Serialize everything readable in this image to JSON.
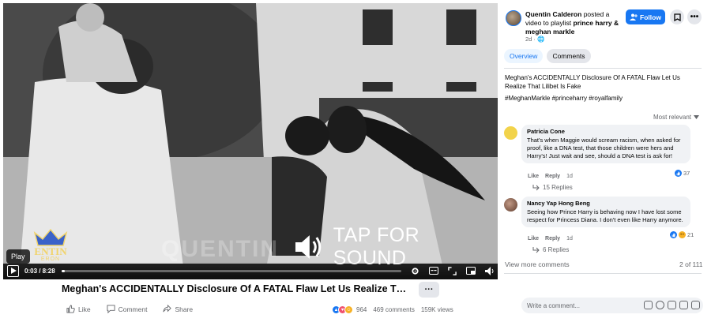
{
  "video": {
    "watermark": "QUENTIN",
    "logo_text": "ENTIN",
    "logo_sub": "ERON",
    "tap_for_sound": "TAP FOR SOUND",
    "play_tooltip": "Play",
    "time": "0:03 / 8:28",
    "progress": 0.01
  },
  "post": {
    "title": "Meghan's ACCIDENTALLY Disclosure Of A FATAL Flaw Let Us Realize That Lilibet Is F...",
    "more_label": "···",
    "like_label": "Like",
    "comment_label": "Comment",
    "share_label": "Share",
    "reaction_count": "964",
    "comments_count": "469 comments",
    "views_count": "159K views"
  },
  "panel": {
    "poster_name": "Quentin Calderon",
    "poster_action": "posted a video to playlist",
    "playlist": "prince harry & meghan markle",
    "age": "2d ·",
    "follow_label": "Follow",
    "tabs": [
      {
        "label": "Overview"
      },
      {
        "label": "Comments"
      }
    ],
    "description": "Meghan's ACCIDENTALLY Disclosure Of A FATAL Flaw Let Us Realize That Lilibet Is Fake",
    "hashtags": "#MeghanMarkle #princeharry #royalfamily",
    "sort_label": "Most relevant"
  },
  "comments": [
    {
      "name": "Patricia Cone",
      "text": "That's when Maggie would scream racism, when asked for proof, like a DNA test, that those children were hers and Harry's! Just wait and see, should a DNA test is ask for!",
      "likes": "37",
      "like_label": "Like",
      "reply_label": "Reply",
      "time": "1d",
      "replies": "15 Replies"
    },
    {
      "name": "Nancy Yap Hong Beng",
      "text": "Seeing how Prince Harry is behaving now I have lost some respect for Princess Diana. I don't even like Harry anymore.",
      "likes": "21",
      "like_label": "Like",
      "reply_label": "Reply",
      "time": "1d",
      "replies": "6 Replies"
    }
  ],
  "footer": {
    "view_more": "View more comments",
    "page_count": "2 of 111",
    "write_placeholder": "Write a comment..."
  },
  "colors": {
    "accent": "#1877f2",
    "bubble": "#f0f2f5",
    "muted": "#65676b"
  }
}
